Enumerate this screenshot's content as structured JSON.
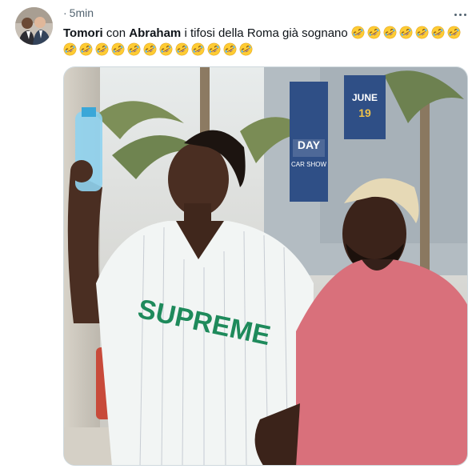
{
  "tweet": {
    "time": "5min",
    "text": {
      "mention1": "Tomori",
      "connector": " con ",
      "mention2": "Abraham",
      "body": " i tifosi della Roma già sognano "
    },
    "emoji_name": "rolling-on-the-floor-laughing",
    "emoji_count_line1": 7,
    "emoji_count_line2": 12,
    "media": {
      "shirt_text": "SUPREME",
      "banner1_text": "DAY",
      "banner1_sub": "CAR\nSHOW",
      "banner2_text": "JUNE",
      "banner2_sub": "19"
    }
  },
  "icons": {
    "more": "more-dots-icon",
    "emoji": "rofl-emoji-icon"
  },
  "colors": {
    "text": "#0f1419",
    "muted": "#536471",
    "border": "#cfd9de",
    "shirt_green": "#1e8a5b",
    "tee_pink": "#d9707b",
    "banner_blue": "#2f4f86"
  }
}
